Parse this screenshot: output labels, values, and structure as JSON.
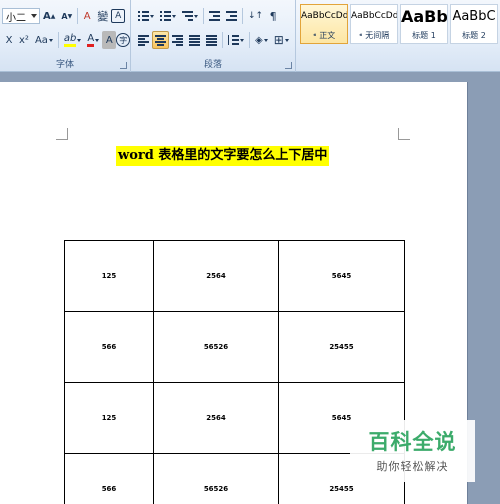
{
  "ribbon": {
    "font_group": {
      "label": "字体",
      "font_size": "小二",
      "grow_font": "A",
      "shrink_font": "A",
      "clear_format": "A",
      "phonetic": "變",
      "char_border": "A",
      "subscript": "X",
      "superscript": "x²",
      "change_case": "Aa",
      "highlight": "ab",
      "font_color": "A",
      "char_shading": "A",
      "enclose": "字"
    },
    "paragraph_group": {
      "label": "段落"
    },
    "styles_group": {
      "items": [
        {
          "sample": "AaBbCcDd",
          "name": "正文",
          "selected": true
        },
        {
          "sample": "AaBbCcDd",
          "name": "无间隔",
          "selected": false
        },
        {
          "sample": "AaBb",
          "name": "标题 1",
          "selected": false
        },
        {
          "sample": "AaBbC",
          "name": "标题 2",
          "selected": false
        }
      ]
    }
  },
  "document": {
    "title": "word 表格里的文字要怎么上下居中",
    "highlight_color": "#ffff00",
    "table": [
      [
        "125",
        "2564",
        "5645"
      ],
      [
        "566",
        "56526",
        "25455"
      ],
      [
        "125",
        "2564",
        "5645"
      ],
      [
        "566",
        "56526",
        "25455"
      ]
    ]
  },
  "watermark": {
    "main": "百科全说",
    "sub": "助你轻松解决",
    "color": "#3cab6b"
  }
}
